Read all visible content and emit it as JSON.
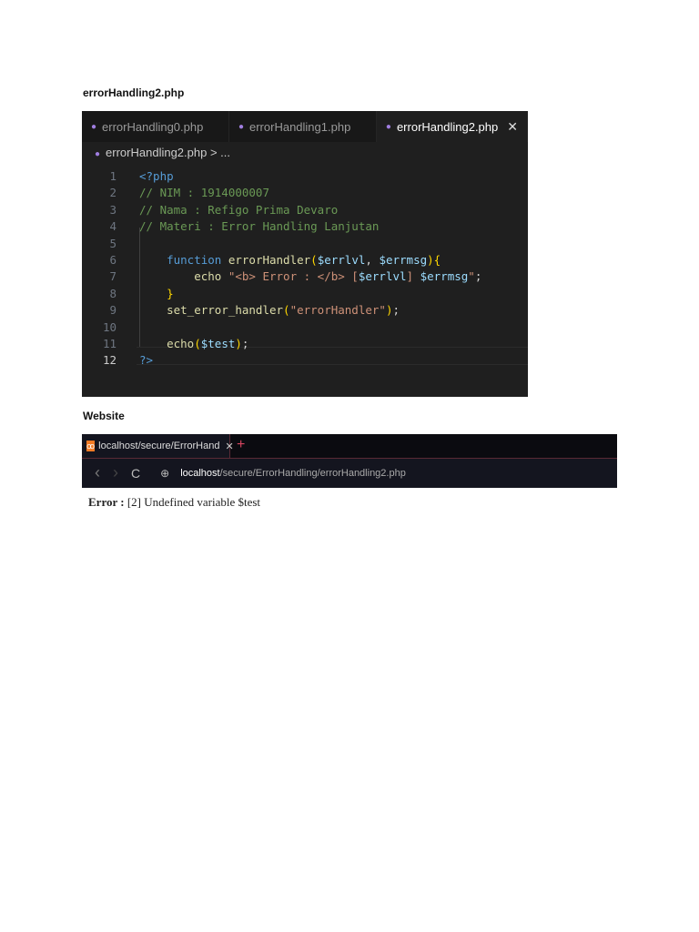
{
  "headings": {
    "file": "errorHandling2.php",
    "website": "Website"
  },
  "editor": {
    "tabs": [
      {
        "label": "errorHandling0.php"
      },
      {
        "label": "errorHandling1.php"
      },
      {
        "label": "errorHandling2.php",
        "close": "✕"
      }
    ],
    "breadcrumb": "errorHandling2.php > ...",
    "lines": [
      {
        "n": "1",
        "t": [
          [
            "<?php",
            "kw"
          ]
        ]
      },
      {
        "n": "2",
        "t": [
          [
            "// NIM : 1914000007",
            "cm"
          ]
        ]
      },
      {
        "n": "3",
        "t": [
          [
            "// Nama : Refigo Prima Devaro",
            "cm"
          ]
        ]
      },
      {
        "n": "4",
        "t": [
          [
            "// Materi : Error Handling Lanjutan",
            "cm"
          ]
        ]
      },
      {
        "n": "5",
        "t": []
      },
      {
        "n": "6",
        "t": [
          [
            "    function ",
            "kw"
          ],
          [
            "errorHandler",
            "fn"
          ],
          [
            "(",
            "br"
          ],
          [
            "$errlvl",
            "var"
          ],
          [
            ", ",
            "pl"
          ],
          [
            "$errmsg",
            "var"
          ],
          [
            "){",
            "br"
          ]
        ]
      },
      {
        "n": "7",
        "t": [
          [
            "        echo ",
            "fn"
          ],
          [
            "\"<b> Error : </b> [",
            "str"
          ],
          [
            "$errlvl",
            "var"
          ],
          [
            "] ",
            "str"
          ],
          [
            "$errmsg",
            "var"
          ],
          [
            "\"",
            "str"
          ],
          [
            ";",
            "pl"
          ]
        ]
      },
      {
        "n": "8",
        "t": [
          [
            "    }",
            "br"
          ]
        ]
      },
      {
        "n": "9",
        "t": [
          [
            "    set_error_handler",
            "fn"
          ],
          [
            "(",
            "br"
          ],
          [
            "\"errorHandler\"",
            "str"
          ],
          [
            ")",
            "br"
          ],
          [
            ";",
            "pl"
          ]
        ]
      },
      {
        "n": "10",
        "t": []
      },
      {
        "n": "11",
        "t": [
          [
            "    echo",
            "fn"
          ],
          [
            "(",
            "br"
          ],
          [
            "$test",
            "var"
          ],
          [
            ")",
            "br"
          ],
          [
            ";",
            "pl"
          ]
        ]
      },
      {
        "n": "12",
        "t": [
          [
            "?>",
            "kw"
          ]
        ]
      }
    ]
  },
  "browser": {
    "tab_title": "localhost/secure/ErrorHand",
    "tab_close": "✕",
    "new_tab": "+",
    "back": "‹",
    "forward": "›",
    "reload": "C",
    "url_host": "localhost",
    "url_path": "/secure/ErrorHandling/errorHandling2.php"
  },
  "output": {
    "label": "Error :",
    "message": " [2] Undefined variable $test"
  }
}
